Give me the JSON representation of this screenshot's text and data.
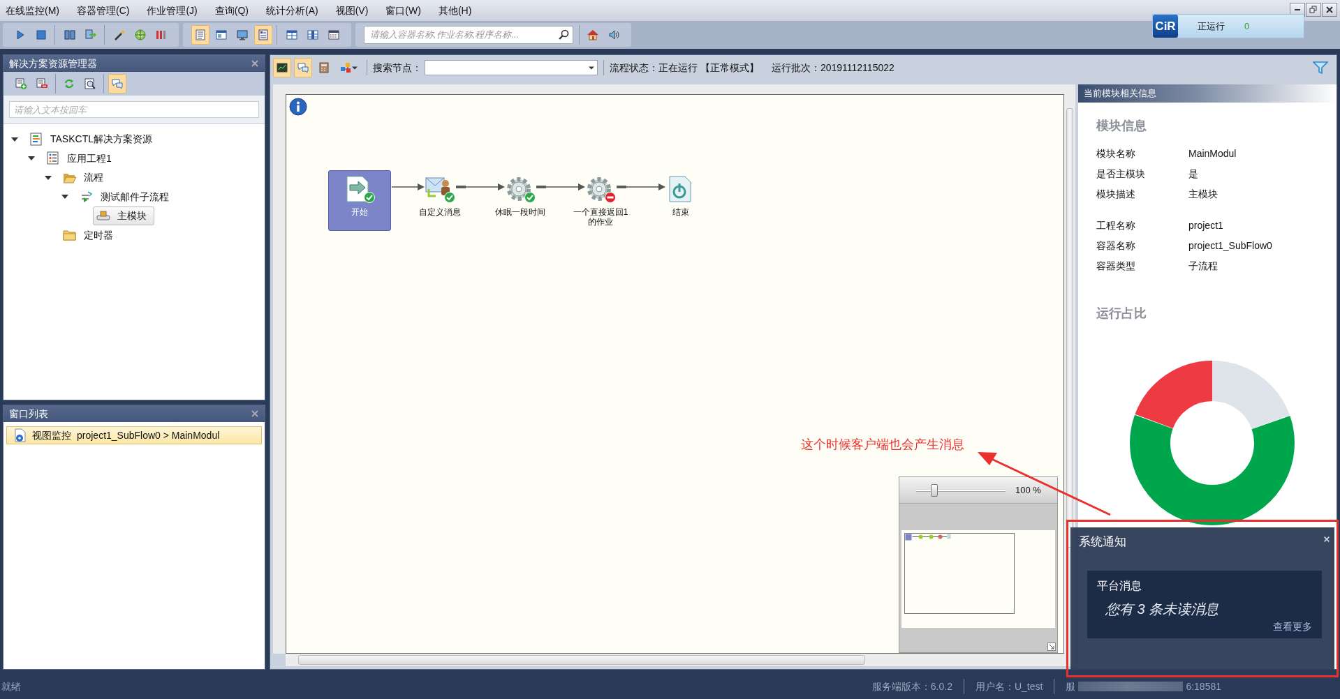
{
  "menu": [
    "在线监控(M)",
    "容器管理(C)",
    "作业管理(J)",
    "查询(Q)",
    "统计分析(A)",
    "视图(V)",
    "窗口(W)",
    "其他(H)"
  ],
  "toolbar": {
    "sections": [
      {
        "groups": [
          [
            {
              "kind": "play",
              "on": false
            },
            {
              "kind": "stop",
              "on": false
            }
          ],
          [
            {
              "kind": "columns",
              "on": false
            },
            {
              "kind": "swap",
              "on": false
            }
          ],
          [
            {
              "kind": "wand",
              "on": false
            },
            {
              "kind": "target",
              "on": false
            },
            {
              "kind": "bars",
              "on": false
            }
          ]
        ]
      },
      {
        "groups": [
          [
            {
              "kind": "doc",
              "on": true
            },
            {
              "kind": "window",
              "on": false
            },
            {
              "kind": "monitor",
              "on": false
            },
            {
              "kind": "panel",
              "on": true
            }
          ],
          [
            {
              "kind": "grid1",
              "on": false
            },
            {
              "kind": "grid2",
              "on": false
            },
            {
              "kind": "grid3",
              "on": false
            }
          ]
        ]
      }
    ],
    "search_placeholder": "请输入容器名称,作业名称,程序名称...",
    "search_section_buttons": [
      {
        "kind": "home",
        "on": false
      },
      {
        "kind": "speaker",
        "on": false
      }
    ]
  },
  "running_badge": {
    "logo": "CiR",
    "label": "正运行",
    "count": "0"
  },
  "explorer": {
    "title": "解决方案资源管理器",
    "buttons": [
      [
        {
          "kind": "add",
          "on": false
        },
        {
          "kind": "remove",
          "on": false
        }
      ],
      [
        {
          "kind": "refresh",
          "on": false
        },
        {
          "kind": "find",
          "on": false
        }
      ],
      [
        {
          "kind": "chat",
          "on": true
        }
      ]
    ],
    "search_placeholder": "请输入文本按回车",
    "tree": [
      {
        "label": "TASKCTL解决方案资源",
        "kind": "solution",
        "expanded": true,
        "selected": false,
        "children": [
          {
            "label": "应用工程1",
            "kind": "project",
            "expanded": true,
            "selected": false,
            "children": [
              {
                "label": "流程",
                "kind": "folder-open",
                "expanded": true,
                "selected": false,
                "children": [
                  {
                    "label": "测试邮件子流程",
                    "kind": "flow",
                    "expanded": true,
                    "selected": false,
                    "children": [
                      {
                        "label": "主模块",
                        "kind": "module",
                        "selected": true
                      }
                    ]
                  }
                ]
              },
              {
                "label": "定时器",
                "kind": "folder",
                "selected": false
              }
            ]
          }
        ]
      }
    ]
  },
  "window_list": {
    "title": "窗口列表",
    "items": [
      {
        "view": "视图监控",
        "title": "project1_SubFlow0 > MainModul",
        "selected": true
      }
    ]
  },
  "flow_toolbar": {
    "buttons": [
      {
        "kind": "chart",
        "on": true
      },
      {
        "kind": "chat",
        "on": true
      },
      {
        "kind": "calc",
        "on": false
      },
      {
        "kind": "network",
        "on": false
      }
    ],
    "search_label": "搜索节点：",
    "status": "流程状态：正在运行 【正常模式】",
    "batch": "运行批次：20191112115022"
  },
  "flow": {
    "nodes": [
      {
        "label": "开始",
        "kind": "start",
        "succeeded": true,
        "failed": false,
        "selected": true
      },
      {
        "label": "自定义消息",
        "kind": "message",
        "succeeded": true,
        "failed": false,
        "selected": false
      },
      {
        "label": "休眠一段时间",
        "kind": "job",
        "succeeded": true,
        "failed": false,
        "selected": false
      },
      {
        "label": "一个直接返回1的作业",
        "kind": "job",
        "succeeded": false,
        "failed": true,
        "selected": false
      },
      {
        "label": "结束",
        "kind": "end",
        "succeeded": false,
        "failed": false,
        "selected": false
      }
    ]
  },
  "overview": {
    "zoom": "100 %",
    "level": 0.2
  },
  "annotation": {
    "text": "这个时候客户端也会产生消息"
  },
  "info_panel": {
    "title": "当前模块相关信息",
    "heading": "模块信息",
    "groups": [
      [
        {
          "label": "模块名称",
          "value": "MainModul"
        },
        {
          "label": "是否主模块",
          "value": "是"
        },
        {
          "label": "模块描述",
          "value": "主模块"
        }
      ],
      [
        {
          "label": "工程名称",
          "value": "project1"
        },
        {
          "label": "容器名称",
          "value": "project1_SubFlow0"
        },
        {
          "label": "容器类型",
          "value": "子流程"
        }
      ]
    ],
    "chart_heading": "运行占比"
  },
  "notification": {
    "title": "系统通知",
    "card_title": "平台消息",
    "message": "您有 3 条未读消息",
    "more": "查看更多"
  },
  "status_bar": {
    "left": "就绪",
    "items": [
      "服务端版本：6.0.2",
      "用户名：U_test"
    ],
    "server_prefix": "服",
    "server_suffix": "6:18581"
  }
}
